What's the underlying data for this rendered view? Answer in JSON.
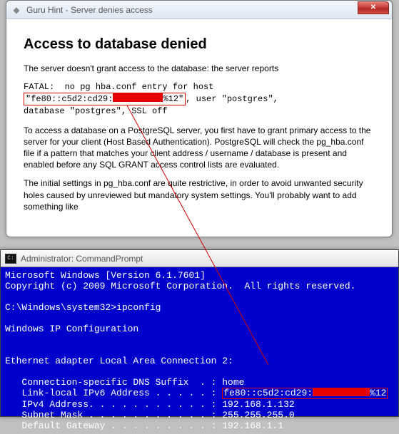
{
  "guru": {
    "title": "Guru Hint - Server denies access",
    "heading": "Access to database denied",
    "intro": "The server doesn't grant access to the database: the server reports",
    "fatal_line1": "FATAL:  no pg hba.conf entry for host",
    "host_prefix": "\"fe80::c5d2:cd29:",
    "host_suffix": "%12\"",
    "fatal_rest": ", user \"postgres\",",
    "fatal_line3": "database \"postgres\", SSL off",
    "para2": "To access a database on a PostgreSQL server, you first have to grant primary access to the server for your client (Host Based Authentication). PostgreSQL will check the pg_hba.conf file if a pattern that matches your client address / username / database is present and enabled before any SQL GRANT access control lists are evaluated.",
    "para3": "The initial settings in pg_hba.conf are quite restrictive, in order to avoid unwanted security holes caused by unreviewed but mandatory system settings. You'll probably want to add something like"
  },
  "cmd": {
    "title": "Administrator: CommandPrompt",
    "line1": "Microsoft Windows [Version 6.1.7601]",
    "line2": "Copyright (c) 2009 Microsoft Corporation.  All rights reserved.",
    "prompt": "C:\\Windows\\system32>ipconfig",
    "heading": "Windows IP Configuration",
    "adapter": "Ethernet adapter Local Area Connection 2:",
    "dns": "   Connection-specific DNS Suffix  . : home",
    "ipv6_label": "   Link-local IPv6 Address . . . . . : ",
    "ipv6_prefix": "fe80::c5d2:cd29:",
    "ipv6_suffix": "%12",
    "ipv4": "   IPv4 Address. . . . . . . . . . . : 192.168.1.132",
    "mask": "   Subnet Mask . . . . . . . . . . . : 255.255.255.0",
    "gw": "   Default Gateway . . . . . . . . . : 192.168.1.1"
  }
}
